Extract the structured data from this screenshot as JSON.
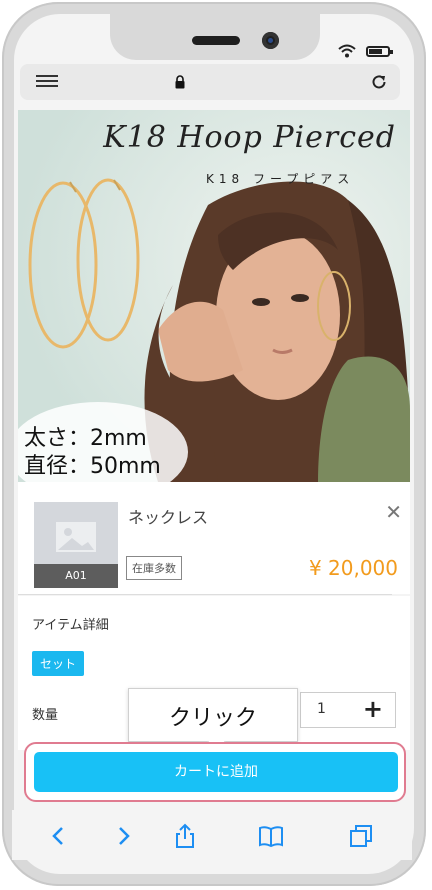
{
  "browser": {
    "address_url": ""
  },
  "hero": {
    "title": "K18 Hoop Pierced",
    "subtitle": "K18 フープピアス",
    "thickness": "太さ：2mm",
    "diameter": "直径：50mm"
  },
  "product": {
    "name": "ネックレス",
    "code": "A01",
    "stock": "在庫多数",
    "price": "¥ 20,000"
  },
  "details": {
    "item_detail_label": "アイテム詳細",
    "set_tag": "セット",
    "quantity_label": "数量",
    "quantity_value": "1"
  },
  "tooltip": {
    "text": "クリック"
  },
  "cart": {
    "button_label": "カートに追加"
  },
  "colors": {
    "accent": "#18c1f6",
    "price": "#f29b1d",
    "highlight": "#e07b90"
  }
}
